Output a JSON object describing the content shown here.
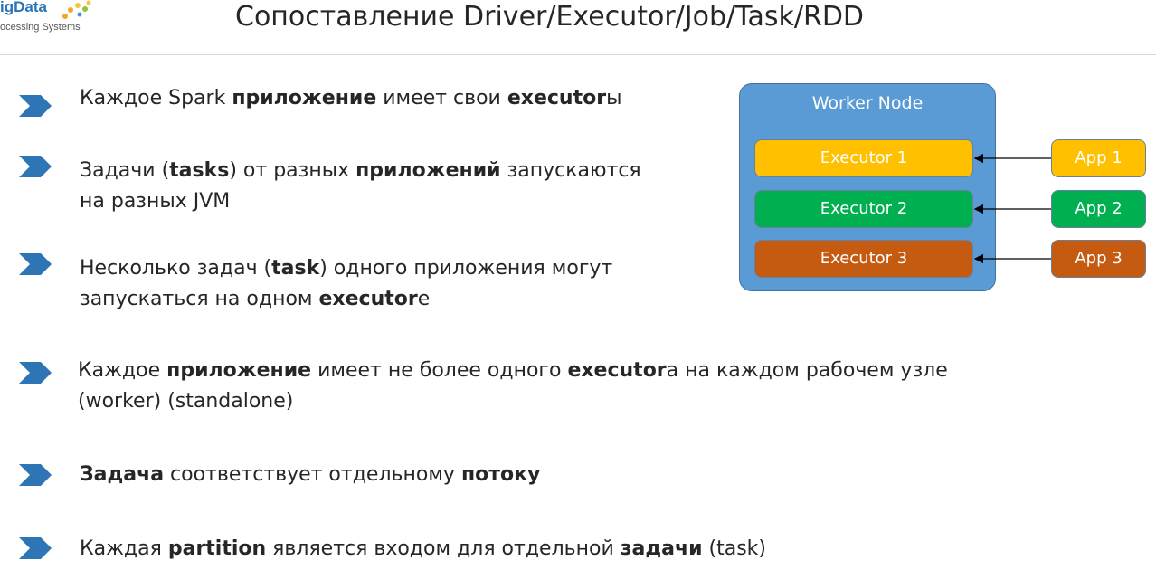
{
  "header": {
    "logo_text": "igData",
    "logo_subtitle": "ocessing Systems",
    "title": "Сопоставление Driver/Executor/Job/Task/RDD"
  },
  "bullets": [
    {
      "parts": [
        "Каждое Spark ",
        "приложение",
        " имеет свои ",
        "executor",
        "ы"
      ]
    },
    {
      "parts": [
        "Задачи (",
        "tasks",
        ") от разных ",
        "приложений",
        " запускаются"
      ],
      "line2": "на разных JVM"
    },
    {
      "parts": [
        "Несколько задач (",
        "task",
        ") одного приложения могут"
      ],
      "line2_parts": [
        "запускаться на одном ",
        "executor",
        "е"
      ]
    },
    {
      "parts": [
        "Каждое ",
        "приложение",
        " имеет не более одного ",
        "executor",
        "а на каждом рабочем узле"
      ],
      "line2": "(worker) (standalone)"
    },
    {
      "parts": [
        "Задача",
        " соответствует отдельному ",
        "потоку"
      ]
    },
    {
      "parts": [
        "Каждая ",
        "partition",
        " является входом для отдельной ",
        "задачи",
        " (task)"
      ]
    }
  ],
  "diagram": {
    "node_label": "Worker Node",
    "executors": [
      "Executor 1",
      "Executor 2",
      "Executor 3"
    ],
    "apps": [
      "App 1",
      "App 2",
      "App 3"
    ],
    "colors": {
      "node": "#5b9bd5",
      "exec1": "#ffc000",
      "exec2": "#00b050",
      "exec3": "#c55a11",
      "bullet_arrow": "#2e75b6"
    }
  }
}
